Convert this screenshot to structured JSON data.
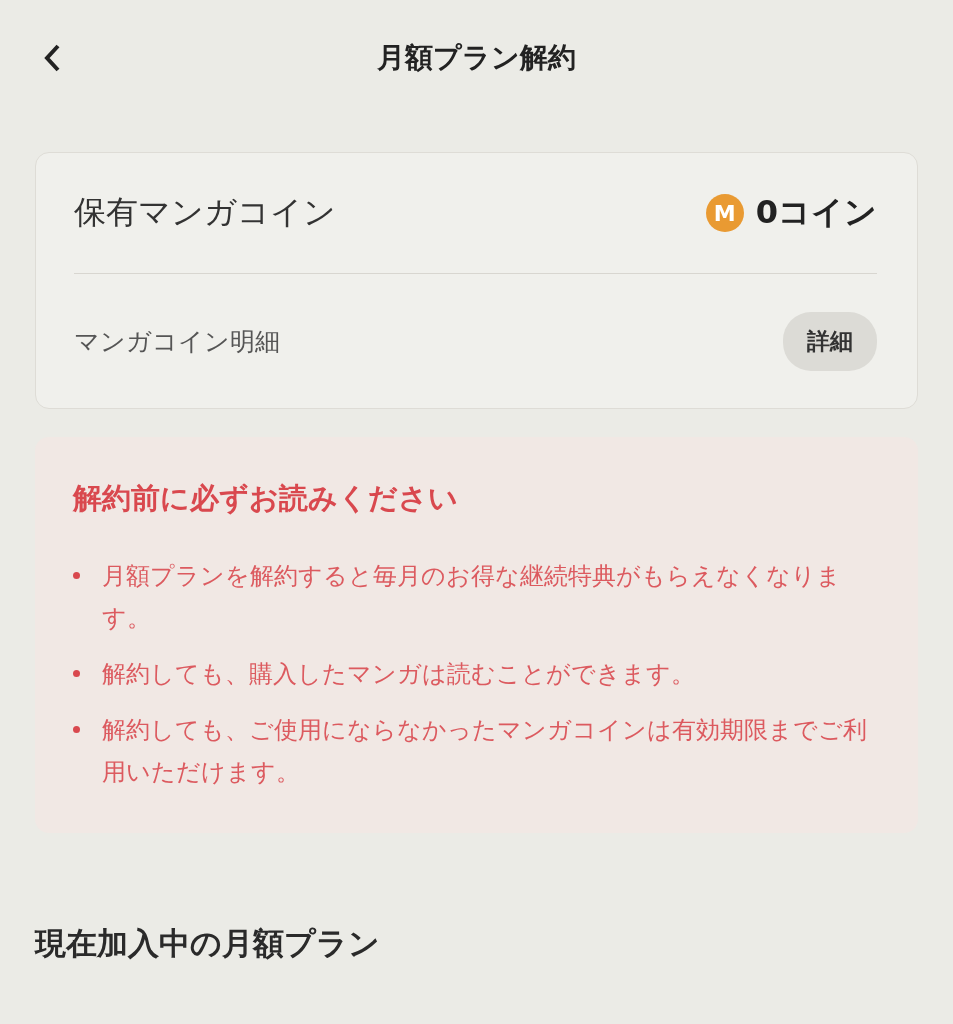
{
  "header": {
    "title": "月額プラン解約"
  },
  "coin_card": {
    "balance_label": "保有マンガコイン",
    "coin_letter": "M",
    "balance": "0コイン",
    "history_label": "マンガコイン明細",
    "details_button": "詳細"
  },
  "notice": {
    "title": "解約前に必ずお読みください",
    "items": [
      "月額プランを解約すると毎月のお得な継続特典がもらえなくなります。",
      "解約しても、購入したマンガは読むことができます。",
      "解約しても、ご使用にならなかったマンガコインは有効期限までご利用いただけます。"
    ]
  },
  "current_plan": {
    "heading": "現在加入中の月額プラン"
  }
}
